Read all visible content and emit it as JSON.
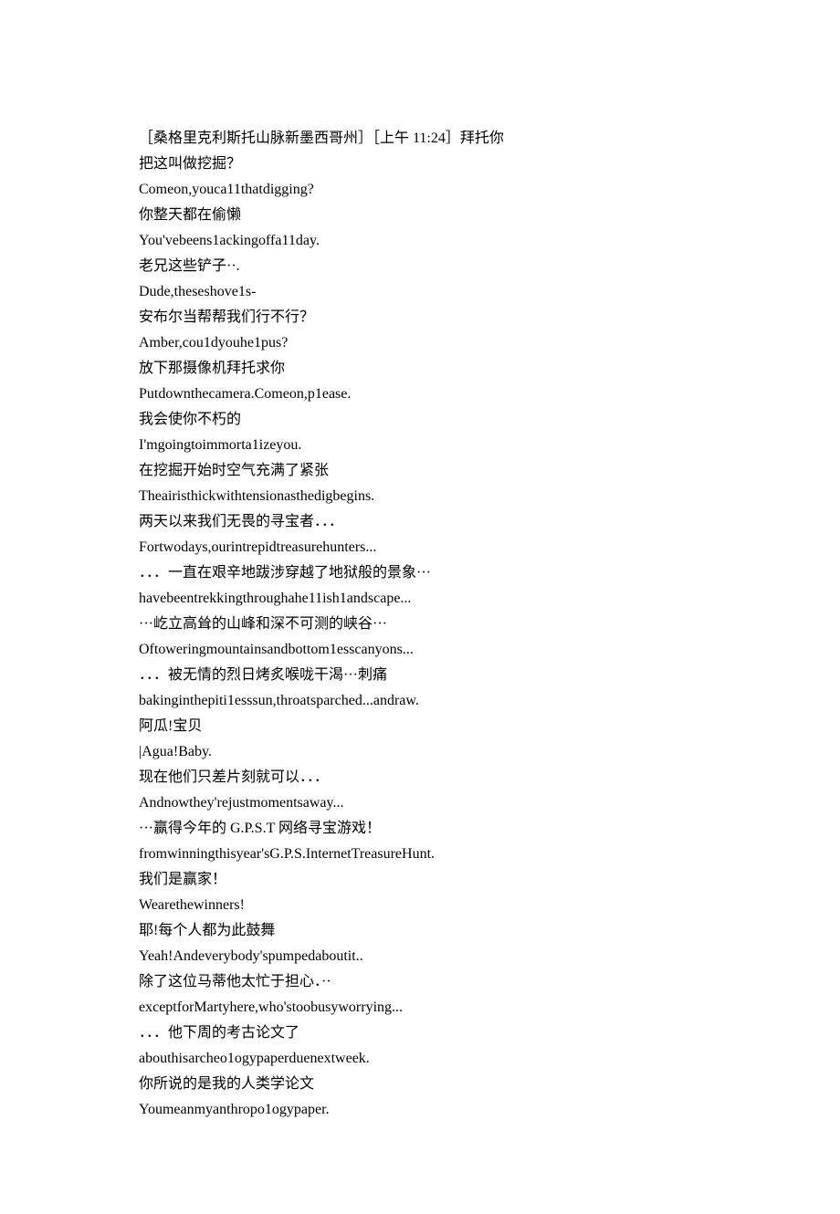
{
  "lines": [
    "［桑格里克利斯托山脉新墨西哥州］［上午 11:24］拜托你",
    "把这叫做挖掘？",
    "Comeon,youca11thatdigging?",
    "你整天都在偷懒",
    "You'vebeens1ackingoffa11day.",
    "老兄这些铲子··.",
    "Dude,theseshove1s-",
    "安布尔当帮帮我们行不行？",
    "Amber,cou1dyouhe1pus?",
    "放下那摄像机拜托求你",
    "Putdownthecamera.Comeon,p1ease.",
    "我会使你不朽的",
    "I'mgoingtoimmorta1izeyou.",
    "在挖掘开始时空气充满了紧张",
    "Theairisthickwithtensionasthedigbegins.",
    "两天以来我们无畏的寻宝者．．．",
    "Fortwodays,ourintrepidtreasurehunters...",
    "．．．一直在艰辛地跋涉穿越了地狱般的景象···",
    "havebeentrekkingthroughahe11ish1andscape...",
    "···屹立高耸的山峰和深不可测的峡谷···",
    "Oftoweringmountainsandbottom1esscanyons...",
    "．．．被无情的烈日烤炙喉咙干渴···刺痛",
    "bakinginthepiti1esssun,throatsparched...andraw.",
    "阿瓜!宝贝",
    "|Agua!Baby.",
    "现在他们只差片刻就可以．．．",
    "Andnowthey'rejustmomentsaway...",
    "···赢得今年的 G.P.S.T 网络寻宝游戏！",
    "fromwinningthisyear'sG.P.S.InternetTreasureHunt.",
    "我们是赢家！",
    "Wearethewinners!",
    "耶!每个人都为此鼓舞",
    "Yeah!Andeverybody'spumpedaboutit..",
    "除了这位马蒂他太忙于担心．··",
    "exceptforMartyhere,who'stoobusyworrying...",
    "．．．他下周的考古论文了",
    "abouthisarcheo1ogypaperduenextweek.",
    "你所说的是我的人类学论文",
    "Youmeanmyanthropo1ogypaper."
  ]
}
